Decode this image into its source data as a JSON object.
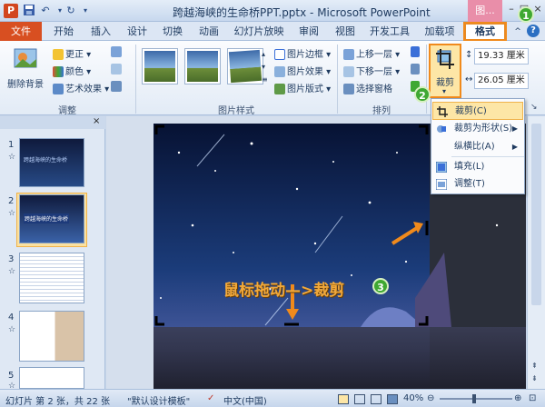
{
  "window": {
    "title": "跨越海峡的生命桥PPT.pptx - Microsoft PowerPoint",
    "app_icon_letter": "P",
    "picture_tools_tab": "图..."
  },
  "tabs": [
    "文件",
    "开始",
    "插入",
    "设计",
    "切换",
    "动画",
    "幻灯片放映",
    "审阅",
    "视图",
    "开发工具",
    "加载项",
    "格式"
  ],
  "ribbon": {
    "adjust": {
      "remove_bg": "删除背景",
      "corrections": "更正",
      "color": "颜色",
      "artistic": "艺术效果",
      "label": "调整"
    },
    "styles": {
      "border": "图片边框",
      "effects": "图片效果",
      "layout": "图片版式",
      "label": "图片样式"
    },
    "arrange": {
      "bring_forward": "上移一层",
      "send_backward": "下移一层",
      "selection_pane": "选择窗格",
      "label": "排列"
    },
    "size": {
      "crop": "裁剪",
      "height": "19.33 厘米",
      "width": "26.05 厘米"
    }
  },
  "crop_menu": {
    "items": [
      {
        "label": "裁剪(C)",
        "has_submenu": false
      },
      {
        "label": "裁剪为形状(S)",
        "has_submenu": true
      },
      {
        "label": "纵横比(A)",
        "has_submenu": true
      },
      {
        "label": "填充(L)",
        "has_submenu": false
      },
      {
        "label": "调整(T)",
        "has_submenu": false
      }
    ]
  },
  "slides": [
    {
      "num": "1",
      "title": "跨越海峡的生命桥"
    },
    {
      "num": "2",
      "title": "跨越海峡的生命桥"
    },
    {
      "num": "3",
      "title": ""
    },
    {
      "num": "4",
      "title": ""
    },
    {
      "num": "5",
      "title": ""
    }
  ],
  "annotations": {
    "step1": "1",
    "step2": "2",
    "step3": "3",
    "drag_text": "鼠标拖动—>裁剪"
  },
  "status": {
    "slide_info": "幻灯片 第 2 张，共 22 张",
    "theme": "\"默认设计模板\"",
    "language": "中文(中国)",
    "zoom": "40%"
  },
  "colors": {
    "accent_orange": "#f08a1c",
    "file_tab": "#d84f21",
    "step_green": "#3fa832"
  }
}
